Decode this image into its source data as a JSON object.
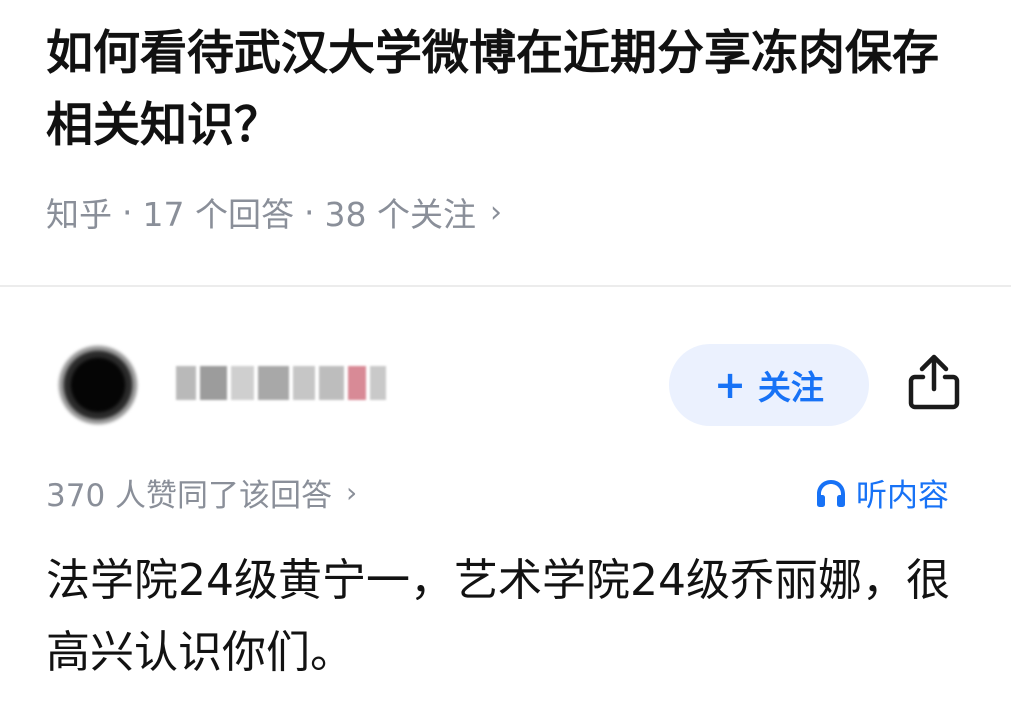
{
  "question": {
    "title": "如何看待武汉大学微博在近期分享冻肉保存相关知识？"
  },
  "meta": {
    "source": "知乎",
    "separator": "·",
    "answers": "17 个回答",
    "followers": "38 个关注",
    "chevron": "›"
  },
  "author": {
    "avatar_icon": "user-avatar-blurred",
    "follow_plus": "+",
    "follow_label": "关注",
    "share_icon": "share-icon"
  },
  "answer": {
    "upvotes": "370 人赞同了该回答",
    "chevron": "›",
    "listen_label": "听内容",
    "listen_icon": "headphones-icon",
    "text": "法学院24级黄宁一，艺术学院24级乔丽娜，很高兴认识你们。"
  },
  "colors": {
    "accent": "#1772f6",
    "follow_bg": "#ebf1fe",
    "meta_gray": "#8a8f99",
    "text": "#121212"
  }
}
